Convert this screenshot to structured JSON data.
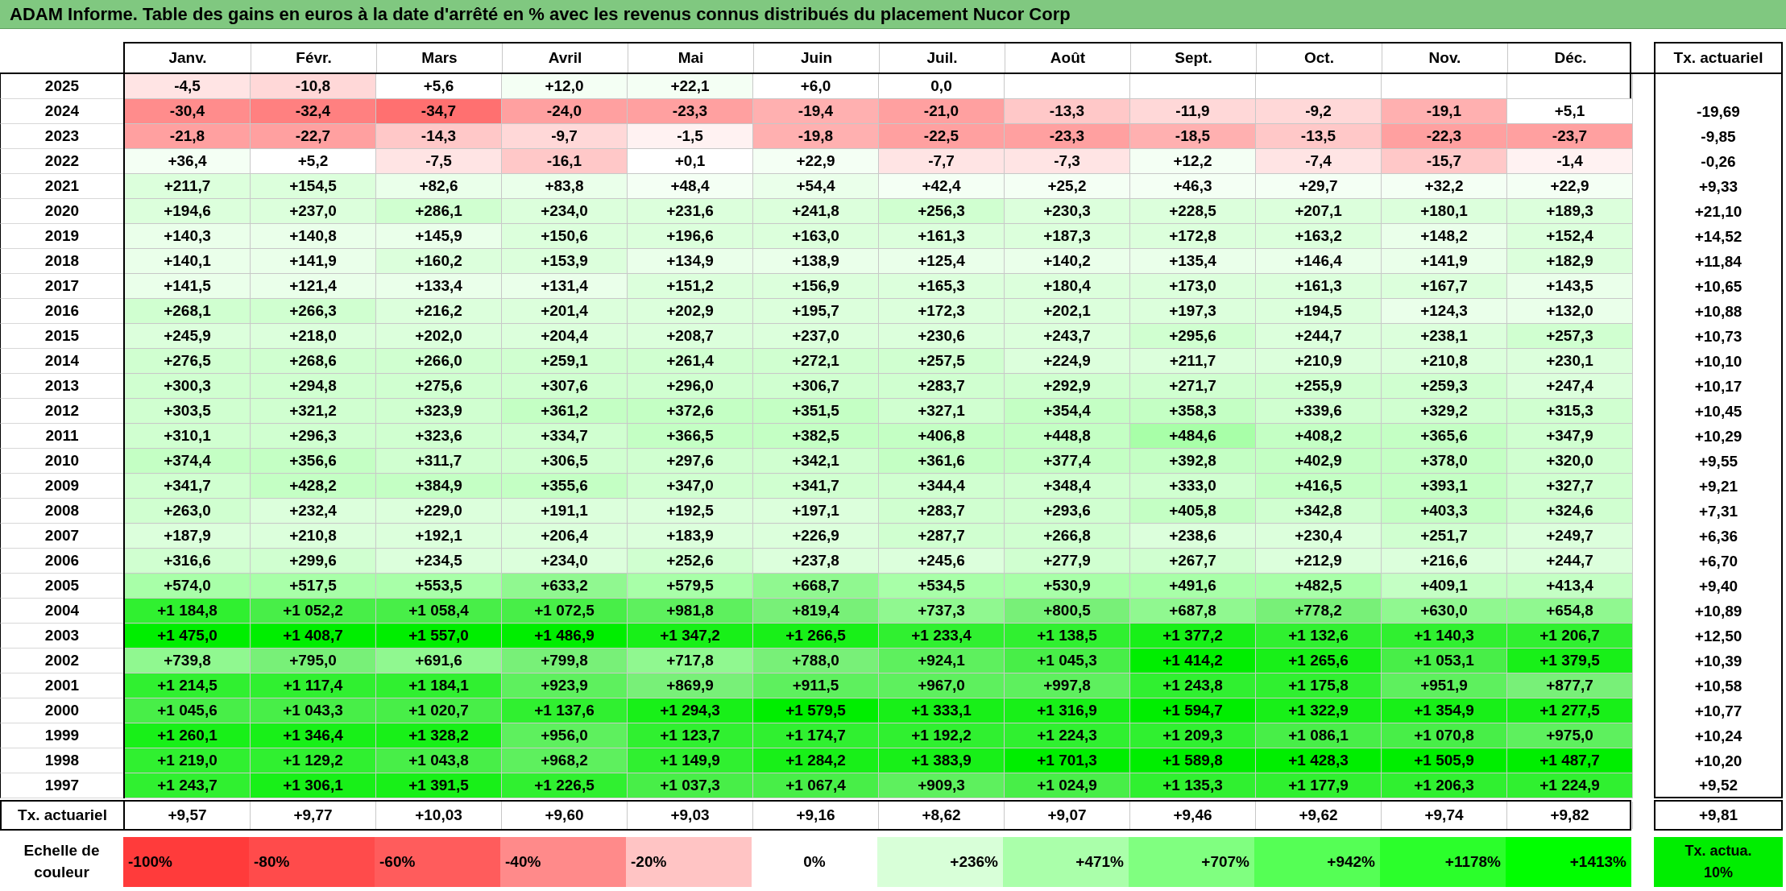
{
  "title": "ADAM Informe. Table des gains en euros à la date d'arrêté en % avec les revenus connus distribués du placement Nucor Corp",
  "columns": [
    "Janv.",
    "Févr.",
    "Mars",
    "Avril",
    "Mai",
    "Juin",
    "Juil.",
    "Août",
    "Sept.",
    "Oct.",
    "Nov.",
    "Déc."
  ],
  "rate_header": "Tx. actuariel",
  "rows": [
    {
      "year": "2025",
      "cells": [
        {
          "v": "-4,5",
          "color": "#ffe4e4"
        },
        {
          "v": "-10,8",
          "color": "#ffd8d8"
        },
        {
          "v": "+5,6",
          "color": "#ffffff"
        },
        {
          "v": "+12,0",
          "color": "#f4fff4"
        },
        {
          "v": "+22,1",
          "color": "#f4fff4"
        },
        {
          "v": "+6,0",
          "color": "#ffffff"
        },
        {
          "v": "0,0",
          "color": "#ffffff"
        }
      ]
    },
    {
      "year": "2024",
      "rate": "-19,69",
      "cells": [
        {
          "v": "-30,4",
          "color": "#ff8c8c"
        },
        {
          "v": "-32,4",
          "color": "#ff8080"
        },
        {
          "v": "-34,7",
          "color": "#ff7070"
        },
        {
          "v": "-24,0",
          "color": "#ffa0a0"
        },
        {
          "v": "-23,3",
          "color": "#ffa0a0"
        },
        {
          "v": "-19,4",
          "color": "#ffb0b0"
        },
        {
          "v": "-21,0",
          "color": "#ffa0a0"
        },
        {
          "v": "-13,3",
          "color": "#ffc8c8"
        },
        {
          "v": "-11,9",
          "color": "#ffd8d8"
        },
        {
          "v": "-9,2",
          "color": "#ffd8d8"
        },
        {
          "v": "-19,1",
          "color": "#ffb0b0"
        },
        {
          "v": "+5,1",
          "color": "#ffffff"
        }
      ]
    },
    {
      "year": "2023",
      "rate": "-9,85",
      "cells": [
        {
          "v": "-21,8",
          "color": "#ffa0a0"
        },
        {
          "v": "-22,7",
          "color": "#ffa0a0"
        },
        {
          "v": "-14,3",
          "color": "#ffc8c8"
        },
        {
          "v": "-9,7",
          "color": "#ffd8d8"
        },
        {
          "v": "-1,5",
          "color": "#fff2f2"
        },
        {
          "v": "-19,8",
          "color": "#ffb0b0"
        },
        {
          "v": "-22,5",
          "color": "#ffa0a0"
        },
        {
          "v": "-23,3",
          "color": "#ffa0a0"
        },
        {
          "v": "-18,5",
          "color": "#ffb0b0"
        },
        {
          "v": "-13,5",
          "color": "#ffc8c8"
        },
        {
          "v": "-22,3",
          "color": "#ffa0a0"
        },
        {
          "v": "-23,7",
          "color": "#ffa0a0"
        }
      ]
    },
    {
      "year": "2022",
      "rate": "-0,26",
      "cells": [
        {
          "v": "+36,4",
          "color": "#f4fff4"
        },
        {
          "v": "+5,2",
          "color": "#ffffff"
        },
        {
          "v": "-7,5",
          "color": "#ffe4e4"
        },
        {
          "v": "-16,1",
          "color": "#ffc8c8"
        },
        {
          "v": "+0,1",
          "color": "#ffffff"
        },
        {
          "v": "+22,9",
          "color": "#f4fff4"
        },
        {
          "v": "-7,7",
          "color": "#ffe4e4"
        },
        {
          "v": "-7,3",
          "color": "#ffe4e4"
        },
        {
          "v": "+12,2",
          "color": "#f4fff4"
        },
        {
          "v": "-7,4",
          "color": "#ffe4e4"
        },
        {
          "v": "-15,7",
          "color": "#ffc8c8"
        },
        {
          "v": "-1,4",
          "color": "#fff2f2"
        }
      ]
    },
    {
      "year": "2021",
      "rate": "+9,33",
      "cells": [
        {
          "v": "+211,7",
          "color": "#dcffdc"
        },
        {
          "v": "+154,5",
          "color": "#dcffdc"
        },
        {
          "v": "+82,6",
          "color": "#eaffea"
        },
        {
          "v": "+83,8",
          "color": "#eaffea"
        },
        {
          "v": "+48,4",
          "color": "#f4fff4"
        },
        {
          "v": "+54,4",
          "color": "#eaffea"
        },
        {
          "v": "+42,4",
          "color": "#f4fff4"
        },
        {
          "v": "+25,2",
          "color": "#f4fff4"
        },
        {
          "v": "+46,3",
          "color": "#f4fff4"
        },
        {
          "v": "+29,7",
          "color": "#f4fff4"
        },
        {
          "v": "+32,2",
          "color": "#f4fff4"
        },
        {
          "v": "+22,9",
          "color": "#f4fff4"
        }
      ]
    },
    {
      "year": "2020",
      "rate": "+21,10",
      "cells": [
        {
          "v": "+194,6",
          "color": "#dcffdc"
        },
        {
          "v": "+237,0",
          "color": "#dcffdc"
        },
        {
          "v": "+286,1",
          "color": "#d0ffd0"
        },
        {
          "v": "+234,0",
          "color": "#dcffdc"
        },
        {
          "v": "+231,6",
          "color": "#dcffdc"
        },
        {
          "v": "+241,8",
          "color": "#dcffdc"
        },
        {
          "v": "+256,3",
          "color": "#d0ffd0"
        },
        {
          "v": "+230,3",
          "color": "#dcffdc"
        },
        {
          "v": "+228,5",
          "color": "#dcffdc"
        },
        {
          "v": "+207,1",
          "color": "#dcffdc"
        },
        {
          "v": "+180,1",
          "color": "#dcffdc"
        },
        {
          "v": "+189,3",
          "color": "#dcffdc"
        }
      ]
    },
    {
      "year": "2019",
      "rate": "+14,52",
      "cells": [
        {
          "v": "+140,3",
          "color": "#eaffea"
        },
        {
          "v": "+140,8",
          "color": "#eaffea"
        },
        {
          "v": "+145,9",
          "color": "#eaffea"
        },
        {
          "v": "+150,6",
          "color": "#dcffdc"
        },
        {
          "v": "+196,6",
          "color": "#dcffdc"
        },
        {
          "v": "+163,0",
          "color": "#dcffdc"
        },
        {
          "v": "+161,3",
          "color": "#dcffdc"
        },
        {
          "v": "+187,3",
          "color": "#dcffdc"
        },
        {
          "v": "+172,8",
          "color": "#dcffdc"
        },
        {
          "v": "+163,2",
          "color": "#dcffdc"
        },
        {
          "v": "+148,2",
          "color": "#eaffea"
        },
        {
          "v": "+152,4",
          "color": "#dcffdc"
        }
      ]
    },
    {
      "year": "2018",
      "rate": "+11,84",
      "cells": [
        {
          "v": "+140,1",
          "color": "#eaffea"
        },
        {
          "v": "+141,9",
          "color": "#eaffea"
        },
        {
          "v": "+160,2",
          "color": "#dcffdc"
        },
        {
          "v": "+153,9",
          "color": "#dcffdc"
        },
        {
          "v": "+134,9",
          "color": "#eaffea"
        },
        {
          "v": "+138,9",
          "color": "#eaffea"
        },
        {
          "v": "+125,4",
          "color": "#eaffea"
        },
        {
          "v": "+140,2",
          "color": "#eaffea"
        },
        {
          "v": "+135,4",
          "color": "#eaffea"
        },
        {
          "v": "+146,4",
          "color": "#eaffea"
        },
        {
          "v": "+141,9",
          "color": "#eaffea"
        },
        {
          "v": "+182,9",
          "color": "#dcffdc"
        }
      ]
    },
    {
      "year": "2017",
      "rate": "+10,65",
      "cells": [
        {
          "v": "+141,5",
          "color": "#eaffea"
        },
        {
          "v": "+121,4",
          "color": "#eaffea"
        },
        {
          "v": "+133,4",
          "color": "#eaffea"
        },
        {
          "v": "+131,4",
          "color": "#eaffea"
        },
        {
          "v": "+151,2",
          "color": "#dcffdc"
        },
        {
          "v": "+156,9",
          "color": "#dcffdc"
        },
        {
          "v": "+165,3",
          "color": "#dcffdc"
        },
        {
          "v": "+180,4",
          "color": "#dcffdc"
        },
        {
          "v": "+173,0",
          "color": "#dcffdc"
        },
        {
          "v": "+161,3",
          "color": "#dcffdc"
        },
        {
          "v": "+167,7",
          "color": "#dcffdc"
        },
        {
          "v": "+143,5",
          "color": "#eaffea"
        }
      ]
    },
    {
      "year": "2016",
      "rate": "+10,88",
      "cells": [
        {
          "v": "+268,1",
          "color": "#d0ffd0"
        },
        {
          "v": "+266,3",
          "color": "#d0ffd0"
        },
        {
          "v": "+216,2",
          "color": "#dcffdc"
        },
        {
          "v": "+201,4",
          "color": "#dcffdc"
        },
        {
          "v": "+202,9",
          "color": "#dcffdc"
        },
        {
          "v": "+195,7",
          "color": "#dcffdc"
        },
        {
          "v": "+172,3",
          "color": "#dcffdc"
        },
        {
          "v": "+202,1",
          "color": "#dcffdc"
        },
        {
          "v": "+197,3",
          "color": "#dcffdc"
        },
        {
          "v": "+194,5",
          "color": "#dcffdc"
        },
        {
          "v": "+124,3",
          "color": "#eaffea"
        },
        {
          "v": "+132,0",
          "color": "#eaffea"
        }
      ]
    },
    {
      "year": "2015",
      "rate": "+10,73",
      "cells": [
        {
          "v": "+245,9",
          "color": "#dcffdc"
        },
        {
          "v": "+218,0",
          "color": "#dcffdc"
        },
        {
          "v": "+202,0",
          "color": "#dcffdc"
        },
        {
          "v": "+204,4",
          "color": "#dcffdc"
        },
        {
          "v": "+208,7",
          "color": "#dcffdc"
        },
        {
          "v": "+237,0",
          "color": "#dcffdc"
        },
        {
          "v": "+230,6",
          "color": "#dcffdc"
        },
        {
          "v": "+243,7",
          "color": "#dcffdc"
        },
        {
          "v": "+295,6",
          "color": "#d0ffd0"
        },
        {
          "v": "+244,7",
          "color": "#dcffdc"
        },
        {
          "v": "+238,1",
          "color": "#dcffdc"
        },
        {
          "v": "+257,3",
          "color": "#d0ffd0"
        }
      ]
    },
    {
      "year": "2014",
      "rate": "+10,10",
      "cells": [
        {
          "v": "+276,5",
          "color": "#d0ffd0"
        },
        {
          "v": "+268,6",
          "color": "#d0ffd0"
        },
        {
          "v": "+266,0",
          "color": "#d0ffd0"
        },
        {
          "v": "+259,1",
          "color": "#d0ffd0"
        },
        {
          "v": "+261,4",
          "color": "#d0ffd0"
        },
        {
          "v": "+272,1",
          "color": "#d0ffd0"
        },
        {
          "v": "+257,5",
          "color": "#d0ffd0"
        },
        {
          "v": "+224,9",
          "color": "#dcffdc"
        },
        {
          "v": "+211,7",
          "color": "#dcffdc"
        },
        {
          "v": "+210,9",
          "color": "#dcffdc"
        },
        {
          "v": "+210,8",
          "color": "#dcffdc"
        },
        {
          "v": "+230,1",
          "color": "#dcffdc"
        }
      ]
    },
    {
      "year": "2013",
      "rate": "+10,17",
      "cells": [
        {
          "v": "+300,3",
          "color": "#d0ffd0"
        },
        {
          "v": "+294,8",
          "color": "#d0ffd0"
        },
        {
          "v": "+275,6",
          "color": "#d0ffd0"
        },
        {
          "v": "+307,6",
          "color": "#d0ffd0"
        },
        {
          "v": "+296,0",
          "color": "#d0ffd0"
        },
        {
          "v": "+306,7",
          "color": "#d0ffd0"
        },
        {
          "v": "+283,7",
          "color": "#d0ffd0"
        },
        {
          "v": "+292,9",
          "color": "#d0ffd0"
        },
        {
          "v": "+271,7",
          "color": "#d0ffd0"
        },
        {
          "v": "+255,9",
          "color": "#d0ffd0"
        },
        {
          "v": "+259,3",
          "color": "#d0ffd0"
        },
        {
          "v": "+247,4",
          "color": "#dcffdc"
        }
      ]
    },
    {
      "year": "2012",
      "rate": "+10,45",
      "cells": [
        {
          "v": "+303,5",
          "color": "#d0ffd0"
        },
        {
          "v": "+321,2",
          "color": "#d0ffd0"
        },
        {
          "v": "+323,9",
          "color": "#d0ffd0"
        },
        {
          "v": "+361,2",
          "color": "#c4ffc4"
        },
        {
          "v": "+372,6",
          "color": "#c4ffc4"
        },
        {
          "v": "+351,5",
          "color": "#c4ffc4"
        },
        {
          "v": "+327,1",
          "color": "#d0ffd0"
        },
        {
          "v": "+354,4",
          "color": "#c4ffc4"
        },
        {
          "v": "+358,3",
          "color": "#c4ffc4"
        },
        {
          "v": "+339,6",
          "color": "#d0ffd0"
        },
        {
          "v": "+329,2",
          "color": "#d0ffd0"
        },
        {
          "v": "+315,3",
          "color": "#d0ffd0"
        }
      ]
    },
    {
      "year": "2011",
      "rate": "+10,29",
      "cells": [
        {
          "v": "+310,1",
          "color": "#d0ffd0"
        },
        {
          "v": "+296,3",
          "color": "#d0ffd0"
        },
        {
          "v": "+323,6",
          "color": "#d0ffd0"
        },
        {
          "v": "+334,7",
          "color": "#d0ffd0"
        },
        {
          "v": "+366,5",
          "color": "#c4ffc4"
        },
        {
          "v": "+382,5",
          "color": "#c4ffc4"
        },
        {
          "v": "+406,8",
          "color": "#c4ffc4"
        },
        {
          "v": "+448,8",
          "color": "#c4ffc4"
        },
        {
          "v": "+484,6",
          "color": "#a8ffa8"
        },
        {
          "v": "+408,2",
          "color": "#c4ffc4"
        },
        {
          "v": "+365,6",
          "color": "#c4ffc4"
        },
        {
          "v": "+347,9",
          "color": "#d0ffd0"
        }
      ]
    },
    {
      "year": "2010",
      "rate": "+9,55",
      "cells": [
        {
          "v": "+374,4",
          "color": "#c4ffc4"
        },
        {
          "v": "+356,6",
          "color": "#c4ffc4"
        },
        {
          "v": "+311,7",
          "color": "#d0ffd0"
        },
        {
          "v": "+306,5",
          "color": "#d0ffd0"
        },
        {
          "v": "+297,6",
          "color": "#d0ffd0"
        },
        {
          "v": "+342,1",
          "color": "#d0ffd0"
        },
        {
          "v": "+361,6",
          "color": "#c4ffc4"
        },
        {
          "v": "+377,4",
          "color": "#c4ffc4"
        },
        {
          "v": "+392,8",
          "color": "#c4ffc4"
        },
        {
          "v": "+402,9",
          "color": "#c4ffc4"
        },
        {
          "v": "+378,0",
          "color": "#c4ffc4"
        },
        {
          "v": "+320,0",
          "color": "#d0ffd0"
        }
      ]
    },
    {
      "year": "2009",
      "rate": "+9,21",
      "cells": [
        {
          "v": "+341,7",
          "color": "#d0ffd0"
        },
        {
          "v": "+428,2",
          "color": "#c4ffc4"
        },
        {
          "v": "+384,9",
          "color": "#c4ffc4"
        },
        {
          "v": "+355,6",
          "color": "#c4ffc4"
        },
        {
          "v": "+347,0",
          "color": "#d0ffd0"
        },
        {
          "v": "+341,7",
          "color": "#d0ffd0"
        },
        {
          "v": "+344,4",
          "color": "#d0ffd0"
        },
        {
          "v": "+348,4",
          "color": "#d0ffd0"
        },
        {
          "v": "+333,0",
          "color": "#d0ffd0"
        },
        {
          "v": "+416,5",
          "color": "#c4ffc4"
        },
        {
          "v": "+393,1",
          "color": "#c4ffc4"
        },
        {
          "v": "+327,7",
          "color": "#d0ffd0"
        }
      ]
    },
    {
      "year": "2008",
      "rate": "+7,31",
      "cells": [
        {
          "v": "+263,0",
          "color": "#d0ffd0"
        },
        {
          "v": "+232,4",
          "color": "#dcffdc"
        },
        {
          "v": "+229,0",
          "color": "#dcffdc"
        },
        {
          "v": "+191,1",
          "color": "#dcffdc"
        },
        {
          "v": "+192,5",
          "color": "#dcffdc"
        },
        {
          "v": "+197,1",
          "color": "#dcffdc"
        },
        {
          "v": "+283,7",
          "color": "#d0ffd0"
        },
        {
          "v": "+293,6",
          "color": "#d0ffd0"
        },
        {
          "v": "+405,8",
          "color": "#c4ffc4"
        },
        {
          "v": "+342,8",
          "color": "#d0ffd0"
        },
        {
          "v": "+403,3",
          "color": "#c4ffc4"
        },
        {
          "v": "+324,6",
          "color": "#d0ffd0"
        }
      ]
    },
    {
      "year": "2007",
      "rate": "+6,36",
      "cells": [
        {
          "v": "+187,9",
          "color": "#dcffdc"
        },
        {
          "v": "+210,8",
          "color": "#dcffdc"
        },
        {
          "v": "+192,1",
          "color": "#dcffdc"
        },
        {
          "v": "+206,4",
          "color": "#dcffdc"
        },
        {
          "v": "+183,9",
          "color": "#dcffdc"
        },
        {
          "v": "+226,9",
          "color": "#dcffdc"
        },
        {
          "v": "+287,7",
          "color": "#d0ffd0"
        },
        {
          "v": "+266,8",
          "color": "#d0ffd0"
        },
        {
          "v": "+238,6",
          "color": "#dcffdc"
        },
        {
          "v": "+230,4",
          "color": "#dcffdc"
        },
        {
          "v": "+251,7",
          "color": "#d0ffd0"
        },
        {
          "v": "+249,7",
          "color": "#dcffdc"
        }
      ]
    },
    {
      "year": "2006",
      "rate": "+6,70",
      "cells": [
        {
          "v": "+316,6",
          "color": "#d0ffd0"
        },
        {
          "v": "+299,6",
          "color": "#d0ffd0"
        },
        {
          "v": "+234,5",
          "color": "#dcffdc"
        },
        {
          "v": "+234,0",
          "color": "#dcffdc"
        },
        {
          "v": "+252,6",
          "color": "#d0ffd0"
        },
        {
          "v": "+237,8",
          "color": "#dcffdc"
        },
        {
          "v": "+245,6",
          "color": "#dcffdc"
        },
        {
          "v": "+277,9",
          "color": "#d0ffd0"
        },
        {
          "v": "+267,7",
          "color": "#d0ffd0"
        },
        {
          "v": "+212,9",
          "color": "#dcffdc"
        },
        {
          "v": "+216,6",
          "color": "#dcffdc"
        },
        {
          "v": "+244,7",
          "color": "#dcffdc"
        }
      ]
    },
    {
      "year": "2005",
      "rate": "+9,40",
      "cells": [
        {
          "v": "+574,0",
          "color": "#a8ffa8"
        },
        {
          "v": "+517,5",
          "color": "#a8ffa8"
        },
        {
          "v": "+553,5",
          "color": "#a8ffa8"
        },
        {
          "v": "+633,2",
          "color": "#90f890"
        },
        {
          "v": "+579,5",
          "color": "#a8ffa8"
        },
        {
          "v": "+668,7",
          "color": "#90f890"
        },
        {
          "v": "+534,5",
          "color": "#a8ffa8"
        },
        {
          "v": "+530,9",
          "color": "#a8ffa8"
        },
        {
          "v": "+491,6",
          "color": "#a8ffa8"
        },
        {
          "v": "+482,5",
          "color": "#a8ffa8"
        },
        {
          "v": "+409,1",
          "color": "#c4ffc4"
        },
        {
          "v": "+413,4",
          "color": "#c4ffc4"
        }
      ]
    },
    {
      "year": "2004",
      "rate": "+10,89",
      "cells": [
        {
          "v": "+1 184,8",
          "color": "#30f030"
        },
        {
          "v": "+1 052,2",
          "color": "#48ee48"
        },
        {
          "v": "+1 058,4",
          "color": "#48ee48"
        },
        {
          "v": "+1 072,5",
          "color": "#48ee48"
        },
        {
          "v": "+981,8",
          "color": "#5ef05e"
        },
        {
          "v": "+819,4",
          "color": "#78f078"
        },
        {
          "v": "+737,3",
          "color": "#90f890"
        },
        {
          "v": "+800,5",
          "color": "#78f078"
        },
        {
          "v": "+687,8",
          "color": "#90f890"
        },
        {
          "v": "+778,2",
          "color": "#78f078"
        },
        {
          "v": "+630,0",
          "color": "#90f890"
        },
        {
          "v": "+654,8",
          "color": "#90f890"
        }
      ]
    },
    {
      "year": "2003",
      "rate": "+12,50",
      "cells": [
        {
          "v": "+1 475,0",
          "color": "#00ee00"
        },
        {
          "v": "+1 408,7",
          "color": "#00ee00"
        },
        {
          "v": "+1 557,0",
          "color": "#00ee00"
        },
        {
          "v": "+1 486,9",
          "color": "#00ee00"
        },
        {
          "v": "+1 347,2",
          "color": "#18f018"
        },
        {
          "v": "+1 266,5",
          "color": "#18f018"
        },
        {
          "v": "+1 233,4",
          "color": "#30f030"
        },
        {
          "v": "+1 138,5",
          "color": "#30f030"
        },
        {
          "v": "+1 377,2",
          "color": "#18f018"
        },
        {
          "v": "+1 132,6",
          "color": "#30f030"
        },
        {
          "v": "+1 140,3",
          "color": "#30f030"
        },
        {
          "v": "+1 206,7",
          "color": "#30f030"
        }
      ]
    },
    {
      "year": "2002",
      "rate": "+10,39",
      "cells": [
        {
          "v": "+739,8",
          "color": "#90f890"
        },
        {
          "v": "+795,0",
          "color": "#78f078"
        },
        {
          "v": "+691,6",
          "color": "#90f890"
        },
        {
          "v": "+799,8",
          "color": "#78f078"
        },
        {
          "v": "+717,8",
          "color": "#90f890"
        },
        {
          "v": "+788,0",
          "color": "#78f078"
        },
        {
          "v": "+924,1",
          "color": "#5ef05e"
        },
        {
          "v": "+1 045,3",
          "color": "#48ee48"
        },
        {
          "v": "+1 414,2",
          "color": "#00ee00"
        },
        {
          "v": "+1 265,6",
          "color": "#18f018"
        },
        {
          "v": "+1 053,1",
          "color": "#48ee48"
        },
        {
          "v": "+1 379,5",
          "color": "#18f018"
        }
      ]
    },
    {
      "year": "2001",
      "rate": "+10,58",
      "cells": [
        {
          "v": "+1 214,5",
          "color": "#30f030"
        },
        {
          "v": "+1 117,4",
          "color": "#30f030"
        },
        {
          "v": "+1 184,1",
          "color": "#30f030"
        },
        {
          "v": "+923,9",
          "color": "#5ef05e"
        },
        {
          "v": "+869,9",
          "color": "#78f078"
        },
        {
          "v": "+911,5",
          "color": "#5ef05e"
        },
        {
          "v": "+967,0",
          "color": "#5ef05e"
        },
        {
          "v": "+997,8",
          "color": "#5ef05e"
        },
        {
          "v": "+1 243,8",
          "color": "#30f030"
        },
        {
          "v": "+1 175,8",
          "color": "#30f030"
        },
        {
          "v": "+951,9",
          "color": "#5ef05e"
        },
        {
          "v": "+877,7",
          "color": "#78f078"
        }
      ]
    },
    {
      "year": "2000",
      "rate": "+10,77",
      "cells": [
        {
          "v": "+1 045,6",
          "color": "#48ee48"
        },
        {
          "v": "+1 043,3",
          "color": "#48ee48"
        },
        {
          "v": "+1 020,7",
          "color": "#48ee48"
        },
        {
          "v": "+1 137,6",
          "color": "#30f030"
        },
        {
          "v": "+1 294,3",
          "color": "#18f018"
        },
        {
          "v": "+1 579,5",
          "color": "#00ee00"
        },
        {
          "v": "+1 333,1",
          "color": "#18f018"
        },
        {
          "v": "+1 316,9",
          "color": "#18f018"
        },
        {
          "v": "+1 594,7",
          "color": "#00ee00"
        },
        {
          "v": "+1 322,9",
          "color": "#18f018"
        },
        {
          "v": "+1 354,9",
          "color": "#18f018"
        },
        {
          "v": "+1 277,5",
          "color": "#18f018"
        }
      ]
    },
    {
      "year": "1999",
      "rate": "+10,24",
      "cells": [
        {
          "v": "+1 260,1",
          "color": "#18f018"
        },
        {
          "v": "+1 346,4",
          "color": "#18f018"
        },
        {
          "v": "+1 328,2",
          "color": "#18f018"
        },
        {
          "v": "+956,0",
          "color": "#5ef05e"
        },
        {
          "v": "+1 123,7",
          "color": "#30f030"
        },
        {
          "v": "+1 174,7",
          "color": "#30f030"
        },
        {
          "v": "+1 192,2",
          "color": "#30f030"
        },
        {
          "v": "+1 224,3",
          "color": "#30f030"
        },
        {
          "v": "+1 209,3",
          "color": "#30f030"
        },
        {
          "v": "+1 086,1",
          "color": "#48ee48"
        },
        {
          "v": "+1 070,8",
          "color": "#48ee48"
        },
        {
          "v": "+975,0",
          "color": "#5ef05e"
        }
      ]
    },
    {
      "year": "1998",
      "rate": "+10,20",
      "cells": [
        {
          "v": "+1 219,0",
          "color": "#30f030"
        },
        {
          "v": "+1 129,2",
          "color": "#30f030"
        },
        {
          "v": "+1 043,8",
          "color": "#48ee48"
        },
        {
          "v": "+968,2",
          "color": "#5ef05e"
        },
        {
          "v": "+1 149,9",
          "color": "#30f030"
        },
        {
          "v": "+1 284,2",
          "color": "#18f018"
        },
        {
          "v": "+1 383,9",
          "color": "#18f018"
        },
        {
          "v": "+1 701,3",
          "color": "#00ee00"
        },
        {
          "v": "+1 589,8",
          "color": "#00ee00"
        },
        {
          "v": "+1 428,3",
          "color": "#00ee00"
        },
        {
          "v": "+1 505,9",
          "color": "#00ee00"
        },
        {
          "v": "+1 487,7",
          "color": "#00ee00"
        }
      ]
    },
    {
      "year": "1997",
      "rate": "+9,52",
      "cells": [
        {
          "v": "+1 243,7",
          "color": "#30f030"
        },
        {
          "v": "+1 306,1",
          "color": "#18f018"
        },
        {
          "v": "+1 391,5",
          "color": "#18f018"
        },
        {
          "v": "+1 226,5",
          "color": "#30f030"
        },
        {
          "v": "+1 037,3",
          "color": "#48ee48"
        },
        {
          "v": "+1 067,4",
          "color": "#48ee48"
        },
        {
          "v": "+909,3",
          "color": "#5ef05e"
        },
        {
          "v": "+1 024,9",
          "color": "#48ee48"
        },
        {
          "v": "+1 135,3",
          "color": "#30f030"
        },
        {
          "v": "+1 177,9",
          "color": "#30f030"
        },
        {
          "v": "+1 206,3",
          "color": "#30f030"
        },
        {
          "v": "+1 224,9",
          "color": "#30f030"
        }
      ]
    }
  ],
  "footer": {
    "label": "Tx. actuariel",
    "values": [
      "+9,57",
      "+9,77",
      "+10,03",
      "+9,60",
      "+9,03",
      "+9,16",
      "+8,62",
      "+9,07",
      "+9,46",
      "+9,62",
      "+9,74",
      "+9,82"
    ],
    "total": "+9,81"
  },
  "legend": {
    "label": "Echelle de couleur",
    "items": [
      {
        "text": "-100%",
        "kind": "negative",
        "color": "#ff3b3b"
      },
      {
        "text": "-80%",
        "kind": "negative",
        "color": "#ff4b4b"
      },
      {
        "text": "-60%",
        "kind": "negative",
        "color": "#ff5c5c"
      },
      {
        "text": "-40%",
        "kind": "negative",
        "color": "#ff8a8a"
      },
      {
        "text": "-20%",
        "kind": "negative",
        "color": "#ffc4c4"
      },
      {
        "text": "0%",
        "kind": "zero",
        "color": "#ffffff"
      },
      {
        "text": "+236%",
        "kind": "positive",
        "color": "#d8ffd8"
      },
      {
        "text": "+471%",
        "kind": "positive",
        "color": "#aaffaa"
      },
      {
        "text": "+707%",
        "kind": "positive",
        "color": "#80ff80"
      },
      {
        "text": "+942%",
        "kind": "positive",
        "color": "#55ff55"
      },
      {
        "text": "+1178%",
        "kind": "positive",
        "color": "#2bff2b"
      },
      {
        "text": "+1413%",
        "kind": "positive",
        "color": "#00ff00"
      }
    ],
    "rate_box": {
      "text": "Tx. actua. 10%",
      "color": "#00ee00"
    }
  }
}
